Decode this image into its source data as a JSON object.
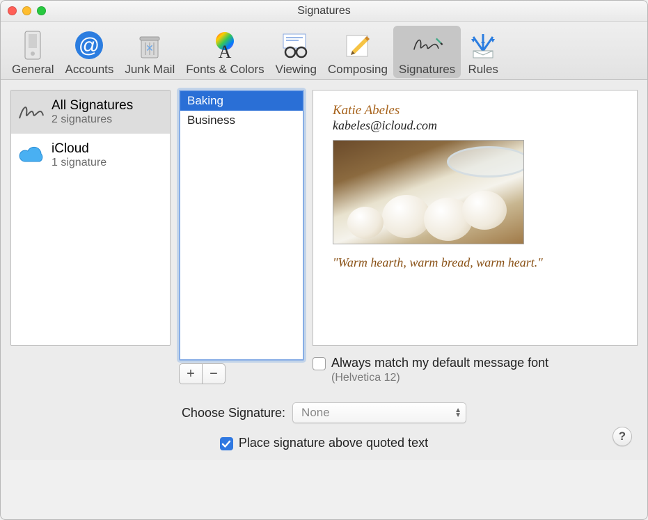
{
  "window": {
    "title": "Signatures"
  },
  "toolbar": {
    "items": [
      {
        "label": "General",
        "icon": "general",
        "active": false
      },
      {
        "label": "Accounts",
        "icon": "at",
        "active": false
      },
      {
        "label": "Junk Mail",
        "icon": "trash",
        "active": false
      },
      {
        "label": "Fonts & Colors",
        "icon": "fonts",
        "active": false
      },
      {
        "label": "Viewing",
        "icon": "glasses",
        "active": false
      },
      {
        "label": "Composing",
        "icon": "compose",
        "active": false
      },
      {
        "label": "Signatures",
        "icon": "signature",
        "active": true
      },
      {
        "label": "Rules",
        "icon": "rules",
        "active": false
      }
    ]
  },
  "accounts": [
    {
      "title": "All Signatures",
      "sub": "2 signatures",
      "icon": "signature-script",
      "selected": true
    },
    {
      "title": "iCloud",
      "sub": "1 signature",
      "icon": "icloud",
      "selected": false
    }
  ],
  "signatures": [
    {
      "name": "Baking",
      "selected": true
    },
    {
      "name": "Business",
      "selected": false
    }
  ],
  "buttons": {
    "add": "+",
    "remove": "−"
  },
  "preview": {
    "name": "Katie Abeles",
    "email": "kabeles@icloud.com",
    "quote": "\"Warm hearth, warm bread, warm heart.\"",
    "image_alt": "baking-eggs-photo"
  },
  "matchFont": {
    "checked": false,
    "label": "Always match my default message font",
    "sub": "(Helvetica 12)"
  },
  "choose": {
    "label": "Choose Signature:",
    "value": "None"
  },
  "placeAbove": {
    "checked": true,
    "label": "Place signature above quoted text"
  },
  "help": "?"
}
